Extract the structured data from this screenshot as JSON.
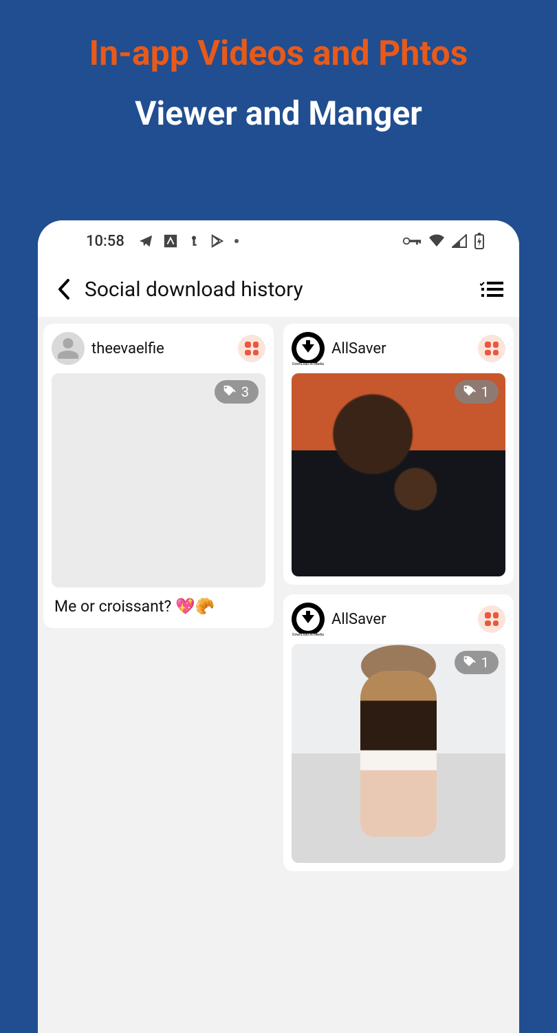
{
  "promo": {
    "line1": "In-app Videos and Phtos",
    "line2": "Viewer and Manger"
  },
  "status_bar": {
    "time": "10:58"
  },
  "header": {
    "title": "Social download history"
  },
  "cards": [
    {
      "username": "theevaelfie",
      "tag_count": "3",
      "caption": "Me or croissant? 💖🥐",
      "avatar_type": "generic"
    },
    {
      "username": "AllSaver",
      "tag_count": "1",
      "avatar_type": "allsaver",
      "avatar_sub": "DownLoad\nAll Media"
    },
    {
      "username": "AllSaver",
      "tag_count": "1",
      "avatar_type": "allsaver",
      "avatar_sub": "DownLoad\nAll Media"
    }
  ]
}
